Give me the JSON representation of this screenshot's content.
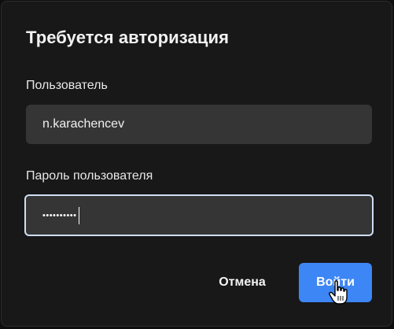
{
  "dialog": {
    "title": "Требуется авторизация",
    "username_label": "Пользователь",
    "username_value": "n.karachencev",
    "password_label": "Пароль пользователя",
    "password_mask": "••••••••••",
    "cancel_label": "Отмена",
    "submit_label": "Войти"
  },
  "colors": {
    "background": "#181818",
    "field": "#353535",
    "focus_border": "#d0def4",
    "primary": "#3d86f5"
  },
  "icons": {
    "cursor": "hand-pointer-icon"
  }
}
